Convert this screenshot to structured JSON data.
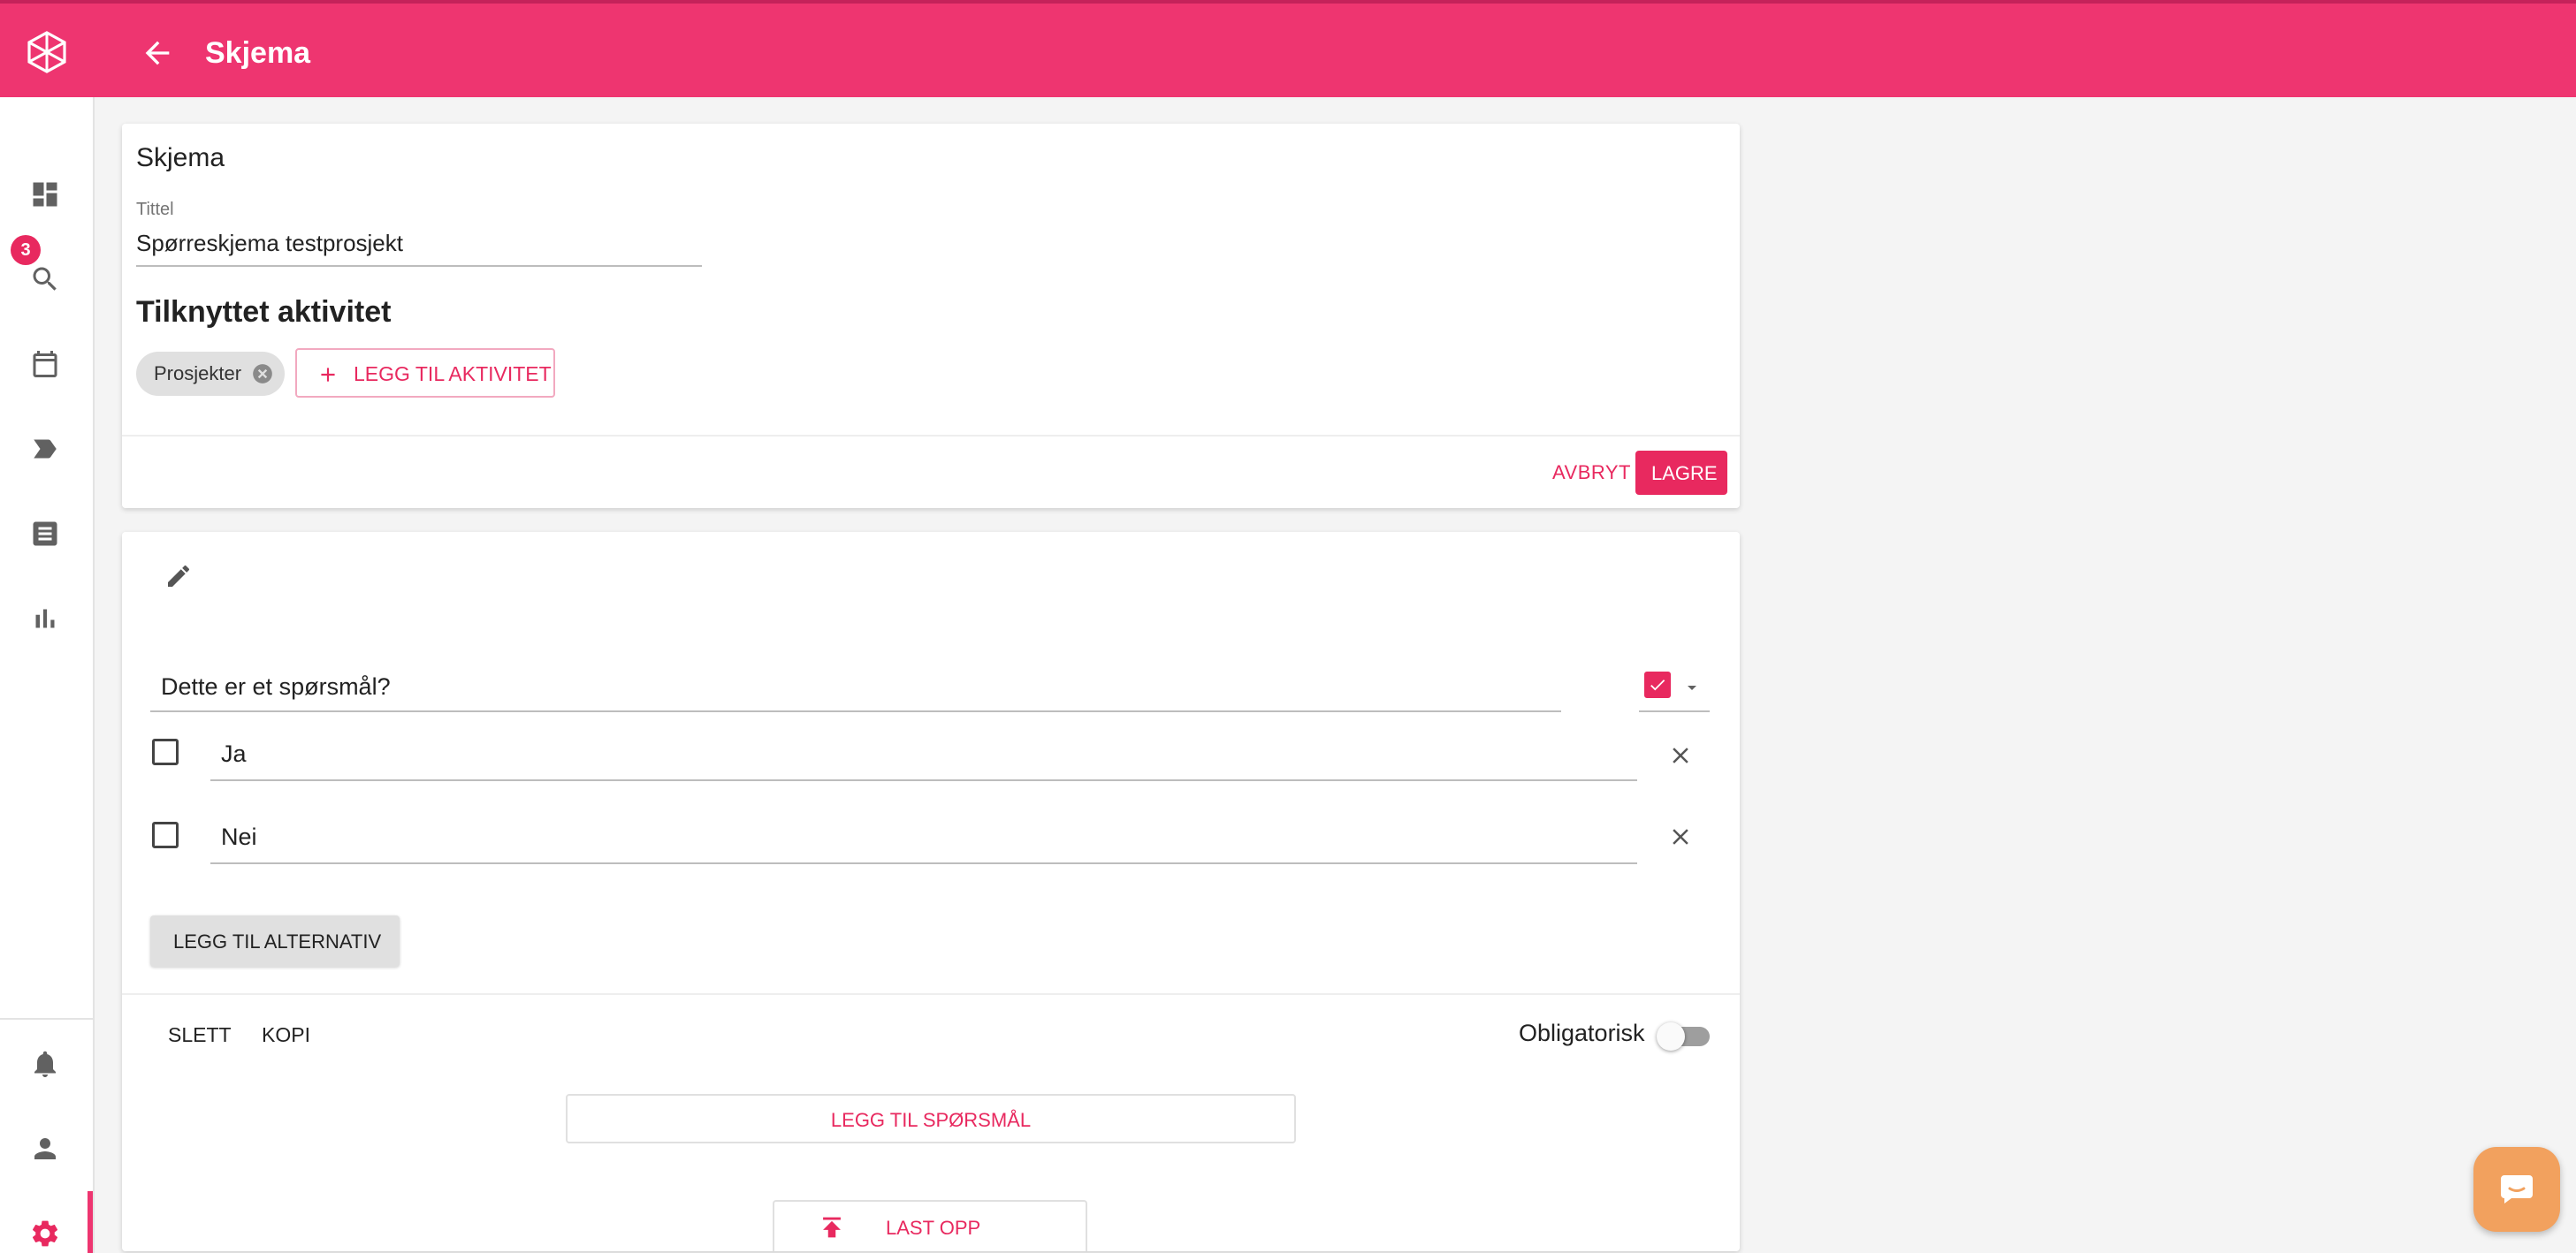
{
  "topbar": {
    "title": "Skjema"
  },
  "sidebar": {
    "items": [
      {
        "name": "dashboard",
        "icon": "dashboard-icon"
      },
      {
        "name": "search",
        "icon": "search-icon"
      },
      {
        "name": "calendar",
        "icon": "calendar-icon",
        "badge": "3"
      },
      {
        "name": "labels",
        "icon": "label-icon"
      },
      {
        "name": "forms",
        "icon": "list-icon"
      },
      {
        "name": "reports",
        "icon": "bar-chart-icon"
      },
      {
        "name": "notifications",
        "icon": "bell-icon"
      },
      {
        "name": "profile",
        "icon": "person-icon"
      },
      {
        "name": "settings",
        "icon": "gear-icon",
        "active": true
      }
    ]
  },
  "form_card": {
    "heading": "Skjema",
    "title_label": "Tittel",
    "title_value": "Spørreskjema testprosjekt",
    "activity_heading": "Tilknyttet aktivitet",
    "activity_chip": "Prosjekter",
    "add_activity_label": "LEGG TIL AKTIVITET",
    "cancel_label": "AVBRYT",
    "save_label": "LAGRE"
  },
  "question_card": {
    "question_text": "Dette er et spørsmål?",
    "options": [
      {
        "label": "Ja"
      },
      {
        "label": "Nei"
      }
    ],
    "add_option_label": "LEGG TIL ALTERNATIV",
    "delete_label": "SLETT",
    "copy_label": "KOPI",
    "required_label": "Obligatorisk",
    "add_question_label": "LEGG TIL SPØRSMÅL",
    "upload_label": "LAST OPP"
  },
  "colors": {
    "accent": "#ee3570",
    "accent_dark": "#e8295f",
    "chat": "#f2a15e"
  }
}
